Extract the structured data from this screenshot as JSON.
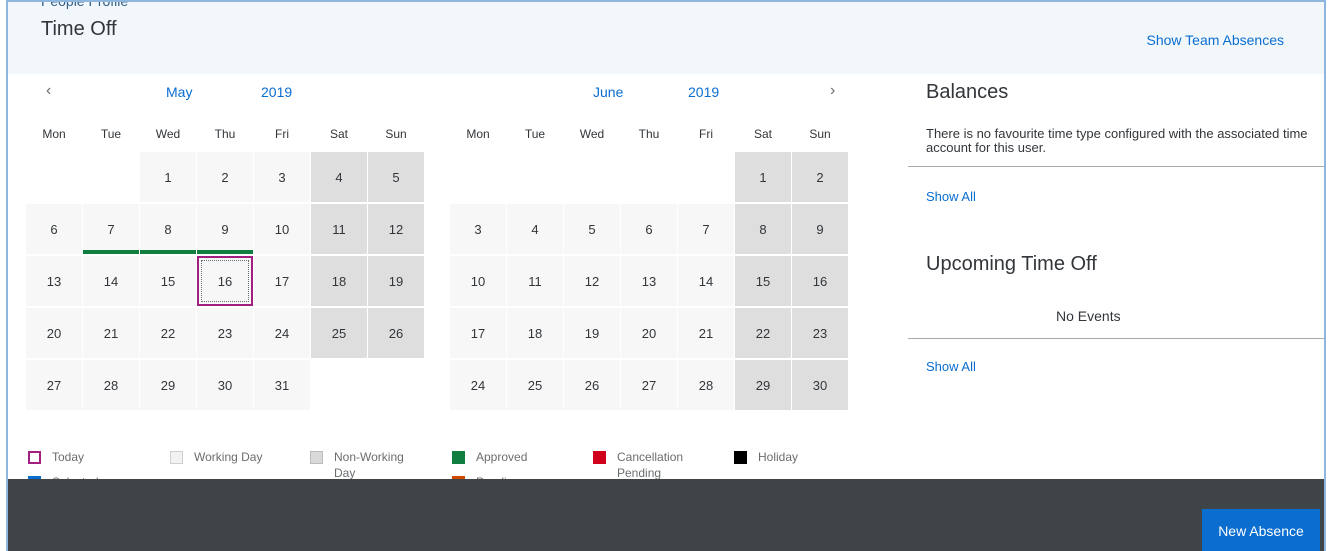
{
  "header": {
    "breadcrumb": "People Profile",
    "title": "Time Off",
    "show_team_absences": "Show Team Absences"
  },
  "calendar": {
    "prev_arrow": "‹",
    "next_arrow": "›",
    "days_of_week": [
      "Mon",
      "Tue",
      "Wed",
      "Thu",
      "Fri",
      "Sat",
      "Sun"
    ],
    "months": [
      {
        "name": "May",
        "year": "2019",
        "first_weekday": 2,
        "num_days": 31,
        "approved": [
          7,
          8,
          9
        ],
        "today": 16
      },
      {
        "name": "June",
        "year": "2019",
        "first_weekday": 5,
        "num_days": 30,
        "approved": [],
        "today": null
      }
    ]
  },
  "balances": {
    "title": "Balances",
    "message": "There is no favourite time type configured with the associated time account for this user.",
    "show_all": "Show All"
  },
  "upcoming": {
    "title": "Upcoming Time Off",
    "message": "No Events",
    "show_all": "Show All"
  },
  "legend": {
    "today": "Today",
    "selected": "Selected",
    "working_day": "Working Day",
    "non_working_day": "Non-Working Day",
    "approved": "Approved",
    "pending": "Pending",
    "cancellation_pending": "Cancellation Pending",
    "holiday": "Holiday",
    "colors": {
      "today": "#a01f80",
      "selected": "#0a6ed1",
      "working_day": "#f2f2f2",
      "non_working_day": "#d9d9d9",
      "approved": "#107e3e",
      "pending": "#d04a02",
      "cancellation_pending": "#d0021b",
      "holiday": "#000000"
    }
  },
  "footer": {
    "new_absence": "New Absence"
  }
}
